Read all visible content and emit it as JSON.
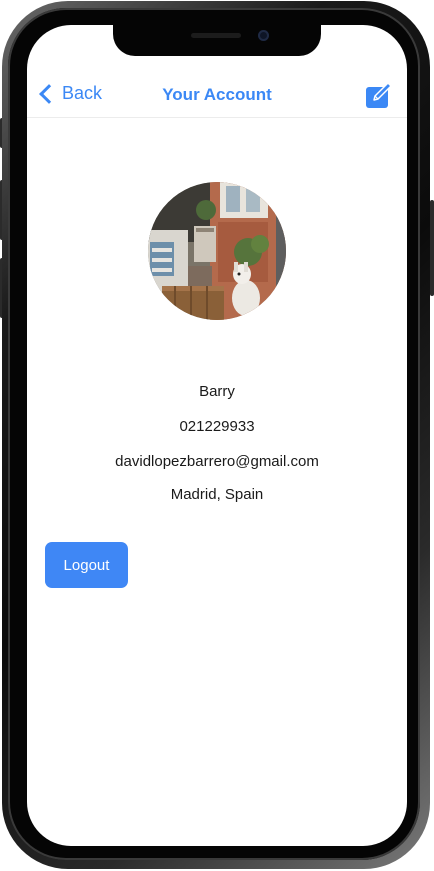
{
  "nav": {
    "back_label": "Back",
    "title": "Your Account",
    "edit_icon": "edit-icon"
  },
  "profile": {
    "name": "Barry",
    "phone": "021229933",
    "email": "davidlopezbarrero@gmail.com",
    "location": "Madrid, Spain"
  },
  "actions": {
    "logout_label": "Logout"
  },
  "colors": {
    "accent": "#3b88f5",
    "button": "#3f87f5"
  }
}
